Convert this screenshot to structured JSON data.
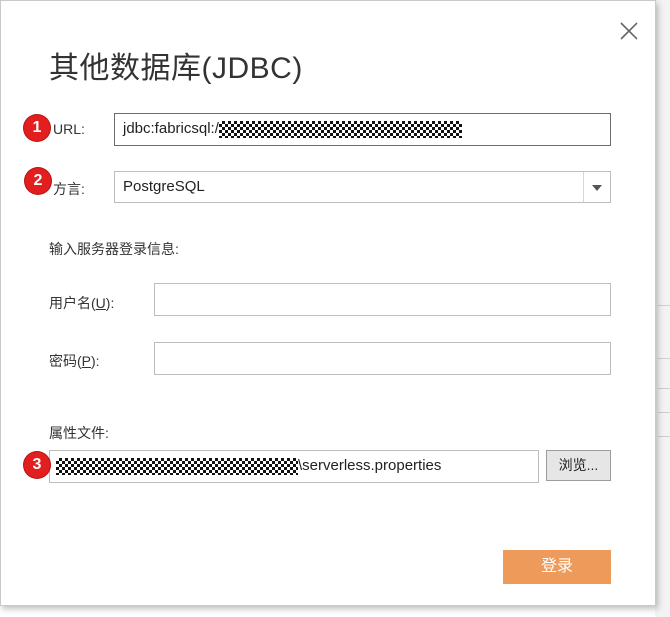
{
  "dialog": {
    "title": "其他数据库(JDBC)",
    "close_icon": "close-icon"
  },
  "url": {
    "label": "URL:",
    "value_prefix": "jdbc:fabricsql:/"
  },
  "dialect": {
    "label": "方言:",
    "selected": "PostgreSQL"
  },
  "login_section": {
    "heading": "输入服务器登录信息:",
    "username_label_pre": "用户名(",
    "username_label_key": "U",
    "username_label_post": "):",
    "username_value": "",
    "password_label_pre": "密码(",
    "password_label_key": "P",
    "password_label_post": "):",
    "password_value": ""
  },
  "properties": {
    "label": "属性文件:",
    "value_suffix": "\\serverless.properties",
    "browse_label": "浏览..."
  },
  "actions": {
    "login_label": "登录"
  },
  "badges": [
    "1",
    "2",
    "3"
  ],
  "colors": {
    "login_button": "#ee9a5b",
    "badge": "#e21e1e"
  }
}
